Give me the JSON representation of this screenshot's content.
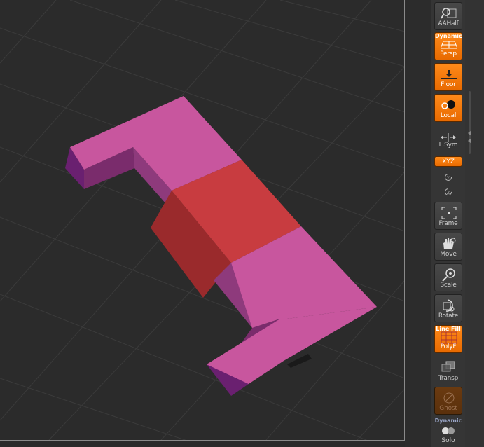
{
  "toolbar": {
    "aahalf": {
      "label": "AAHalf",
      "icon": "magnifier-grid-icon",
      "active": false
    },
    "persp": {
      "top_label": "Dynamic",
      "label": "Persp",
      "icon": "perspective-grid-icon",
      "active": true
    },
    "floor": {
      "label": "Floor",
      "icon": "floor-icon",
      "active": true
    },
    "local": {
      "label": "Local",
      "icon": "local-pivot-icon",
      "active": true
    },
    "lsym": {
      "label": "L.Sym",
      "icon": "symmetry-arrows-icon",
      "active": false
    },
    "xyz": {
      "label": "XYZ",
      "active": true
    },
    "rot_y": {
      "label": "Y",
      "icon": "rotate-y-icon"
    },
    "rot_z": {
      "label": "Z",
      "icon": "rotate-z-icon"
    },
    "frame": {
      "label": "Frame",
      "icon": "frame-icon"
    },
    "move": {
      "label": "Move",
      "icon": "hand-icon"
    },
    "scale": {
      "label": "Scale",
      "icon": "scale-magnifier-icon"
    },
    "rotate": {
      "label": "Rotate",
      "icon": "rotate-icon"
    },
    "polyf": {
      "top_label": "Line Fill",
      "label": "PolyF",
      "icon": "polyframe-grid-icon",
      "active": true
    },
    "transp": {
      "label": "Transp",
      "icon": "transparency-icon",
      "active": false
    },
    "ghost": {
      "label": "Ghost",
      "icon": "ghost-icon",
      "disabled": true
    },
    "solo": {
      "top_label": "Dynamic",
      "label": "Solo",
      "icon": "solo-spheres-icon"
    }
  },
  "colors": {
    "accent": "#f07810",
    "mesh_pink": "#c8569e",
    "mesh_selected": "#c83c40",
    "background": "#2b2b2b"
  }
}
